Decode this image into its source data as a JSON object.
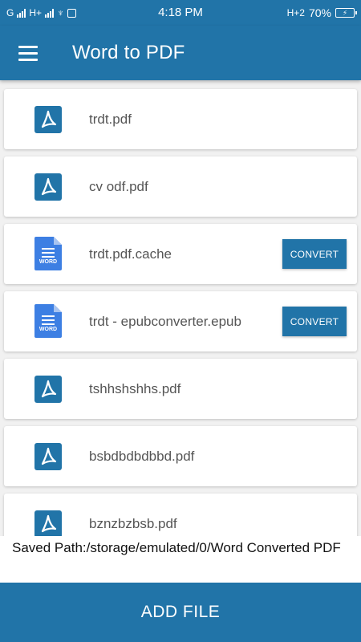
{
  "status_bar": {
    "carrier_left": "G",
    "network_mid": "H+",
    "time": "4:18 PM",
    "network_right": "H+2",
    "battery_percent": "70%"
  },
  "app_bar": {
    "menu_icon": "hamburger-menu-icon",
    "title": "Word to PDF"
  },
  "files": [
    {
      "name": "trdt.pdf",
      "type": "pdf",
      "convert_label": ""
    },
    {
      "name": "cv odf.pdf",
      "type": "pdf",
      "convert_label": ""
    },
    {
      "name": "trdt.pdf.cache",
      "type": "word",
      "convert_label": "CONVERT"
    },
    {
      "name": "trdt - epubconverter.epub",
      "type": "word",
      "convert_label": "CONVERT"
    },
    {
      "name": "tshhshshhs.pdf",
      "type": "pdf",
      "convert_label": ""
    },
    {
      "name": "bsbdbdbdbbd.pdf",
      "type": "pdf",
      "convert_label": ""
    },
    {
      "name": "bznzbzbsb.pdf",
      "type": "pdf",
      "convert_label": ""
    }
  ],
  "word_icon_label": "WORD",
  "saved_path": "Saved Path:/storage/emulated/0/Word Converted PDF",
  "add_file_label": "ADD FILE",
  "colors": {
    "primary": "#2174a8",
    "word_blue": "#3d7fe3",
    "pdf_blue": "#2174a8",
    "background": "#f1f1f1"
  }
}
